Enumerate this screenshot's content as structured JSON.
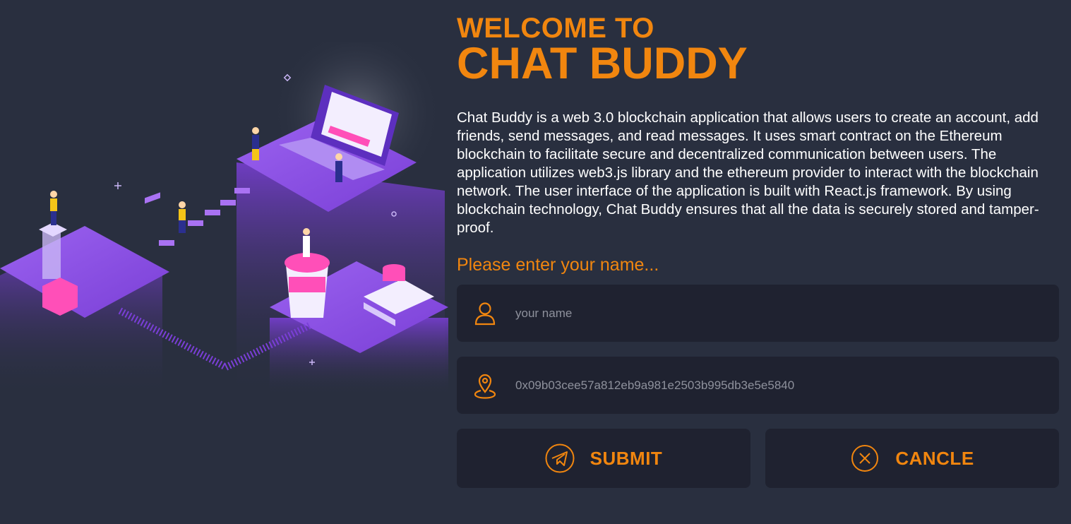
{
  "header": {
    "welcome": "WELCOME TO",
    "app_name": "CHAT BUDDY"
  },
  "description": "Chat Buddy is a web 3.0 blockchain application that allows users to create an account, add friends, send messages, and read messages. It uses smart contract on the Ethereum blockchain to facilitate secure and decentralized communication between users. The application utilizes web3.js library and the ethereum provider to interact with the blockchain network. The user interface of the application is built with React.js framework. By using blockchain technology, Chat Buddy ensures that all the data is securely stored and tamper-proof.",
  "form": {
    "prompt": "Please enter your name...",
    "name_field": {
      "placeholder": "your name",
      "value": "",
      "icon": "user-icon"
    },
    "address_field": {
      "value": "0x09b03cee57a812eb9a981e2503b995db3e5e5840",
      "icon": "location-pin-icon"
    }
  },
  "buttons": {
    "submit": {
      "label": "SUBMIT",
      "icon": "send-icon"
    },
    "cancel": {
      "label": "CANCLE",
      "icon": "close-circle-icon"
    }
  },
  "colors": {
    "background": "#292f3f",
    "panel": "#1f2230",
    "accent": "#f1860f",
    "text": "#ffffff",
    "muted": "#8e919c",
    "illustration_purple": "#7b3fd8",
    "illustration_pink": "#ff4fb8"
  }
}
